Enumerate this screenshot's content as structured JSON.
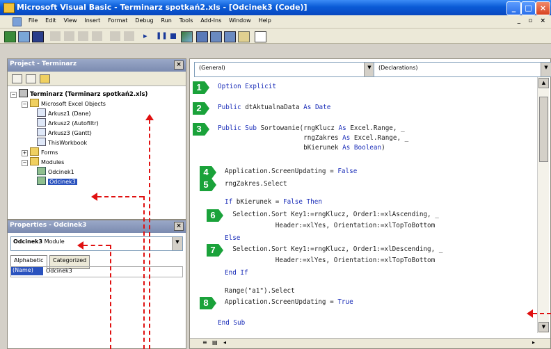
{
  "window": {
    "title": "Microsoft Visual Basic - Terminarz spotkań2.xls - [Odcinek3 (Code)]",
    "buttons": [
      "_",
      "□",
      "×"
    ]
  },
  "menu": [
    "File",
    "Edit",
    "View",
    "Insert",
    "Format",
    "Debug",
    "Run",
    "Tools",
    "Add-Ins",
    "Window",
    "Help"
  ],
  "mdi_controls": "_ ▫ ×",
  "project": {
    "title": "Project - Terminarz",
    "root": "Terminarz (Terminarz spotkań2.xls)",
    "excel_objects": "Microsoft Excel Objects",
    "sheets": [
      "Arkusz1 (Dane)",
      "Arkusz2 (Autofiltr)",
      "Arkusz3 (Gantt)",
      "ThisWorkbook"
    ],
    "forms": "Forms",
    "modules": "Modules",
    "module_items": [
      "Odcinek1",
      "Odcinek3"
    ]
  },
  "properties": {
    "title": "Properties - Odcinek3",
    "object_name": "Odcinek3",
    "object_type": "Module",
    "tabs": [
      "Alphabetic",
      "Categorized"
    ],
    "name_key": "(Name)",
    "name_value": "Odcinek3"
  },
  "code": {
    "object_combo": "(General)",
    "proc_combo": "(Declarations)",
    "lines": [
      {
        "parts": [
          [
            "kw",
            "Option Explicit"
          ]
        ]
      },
      {
        "parts": [
          [
            "kw",
            "Public "
          ],
          [
            "t",
            "dtAktualnaData "
          ],
          [
            "kw",
            "As Date"
          ]
        ]
      },
      {
        "parts": [
          [
            "kw",
            "Public Sub "
          ],
          [
            "t",
            "Sortowanie(rngKlucz "
          ],
          [
            "kw",
            "As "
          ],
          [
            "t",
            "Excel.Range, _"
          ]
        ]
      },
      {
        "parts": [
          [
            "t",
            "                      rngZakres "
          ],
          [
            "kw",
            "As "
          ],
          [
            "t",
            "Excel.Range, _"
          ]
        ]
      },
      {
        "parts": [
          [
            "t",
            "                      bKierunek "
          ],
          [
            "kw",
            "As Boolean"
          ],
          [
            "t",
            ")"
          ]
        ]
      },
      {
        "parts": [
          [
            "t",
            "Application.ScreenUpdating = "
          ],
          [
            "kw",
            "False"
          ]
        ]
      },
      {
        "parts": [
          [
            "t",
            "rngZakres.Select"
          ]
        ]
      },
      {
        "parts": [
          [
            "kw",
            "If "
          ],
          [
            "t",
            "bKierunek = "
          ],
          [
            "kw",
            "False Then"
          ]
        ]
      },
      {
        "parts": [
          [
            "t",
            "  Selection.Sort Key1:=rngKlucz, Order1:=xlAscending, _"
          ]
        ]
      },
      {
        "parts": [
          [
            "t",
            "             Header:=xlYes, Orientation:=xlTopToBottom"
          ]
        ]
      },
      {
        "parts": [
          [
            "kw",
            "Else"
          ]
        ]
      },
      {
        "parts": [
          [
            "t",
            "  Selection.Sort Key1:=rngKlucz, Order1:=xlDescending, _"
          ]
        ]
      },
      {
        "parts": [
          [
            "t",
            "             Header:=xlYes, Orientation:=xlTopToBottom"
          ]
        ]
      },
      {
        "parts": [
          [
            "kw",
            "End If"
          ]
        ]
      },
      {
        "parts": [
          [
            "t",
            "Range(\"a1\").Select"
          ]
        ]
      },
      {
        "parts": [
          [
            "t",
            "Application.ScreenUpdating = "
          ],
          [
            "kw",
            "True"
          ]
        ]
      },
      {
        "parts": [
          [
            "kw",
            "End Sub"
          ]
        ]
      }
    ],
    "badges": [
      "1",
      "2",
      "3",
      "4",
      "5",
      "6",
      "7",
      "8"
    ]
  },
  "colors": {
    "keyword": "#1a2db8",
    "badge": "#1aa23a",
    "annotation_arrow": "#e01010",
    "titlebar": "#0a5bd6"
  }
}
